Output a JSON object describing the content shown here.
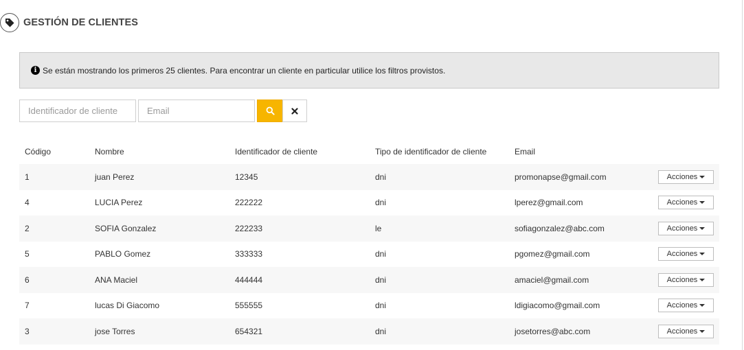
{
  "header": {
    "title": "GESTIÓN DE CLIENTES",
    "icon": "tag-icon"
  },
  "alert": {
    "icon": "info-circle-icon",
    "text": "Se están mostrando los primeros 25 clientes. Para encontrar un cliente en particular utilice los filtros provistos."
  },
  "filters": {
    "identifier_placeholder": "Identificador de cliente",
    "identifier_value": "",
    "email_placeholder": "Email",
    "email_value": "",
    "search_icon": "search-icon",
    "clear_icon": "times-icon",
    "search_color": "#f7b500"
  },
  "table": {
    "headers": [
      "Código",
      "Nombre",
      "Identificador de cliente",
      "Tipo de identificador de cliente",
      "Email"
    ],
    "actions_label": "Acciones",
    "rows": [
      {
        "code": "1",
        "name": "juan Perez",
        "identifier": "12345",
        "type": "dni",
        "email": "promonapse@gmail.com"
      },
      {
        "code": "4",
        "name": "LUCIA Perez",
        "identifier": "222222",
        "type": "dni",
        "email": "lperez@gmail.com"
      },
      {
        "code": "2",
        "name": "SOFIA Gonzalez",
        "identifier": "222233",
        "type": "le",
        "email": "sofiagonzalez@abc.com"
      },
      {
        "code": "5",
        "name": "PABLO Gomez",
        "identifier": "333333",
        "type": "dni",
        "email": "pgomez@gmail.com"
      },
      {
        "code": "6",
        "name": "ANA Maciel",
        "identifier": "444444",
        "type": "dni",
        "email": "amaciel@gmail.com"
      },
      {
        "code": "7",
        "name": "lucas Di Giacomo",
        "identifier": "555555",
        "type": "dni",
        "email": "ldigiacomo@gmail.com"
      },
      {
        "code": "3",
        "name": "jose Torres",
        "identifier": "654321",
        "type": "dni",
        "email": "josetorres@abc.com"
      }
    ]
  }
}
